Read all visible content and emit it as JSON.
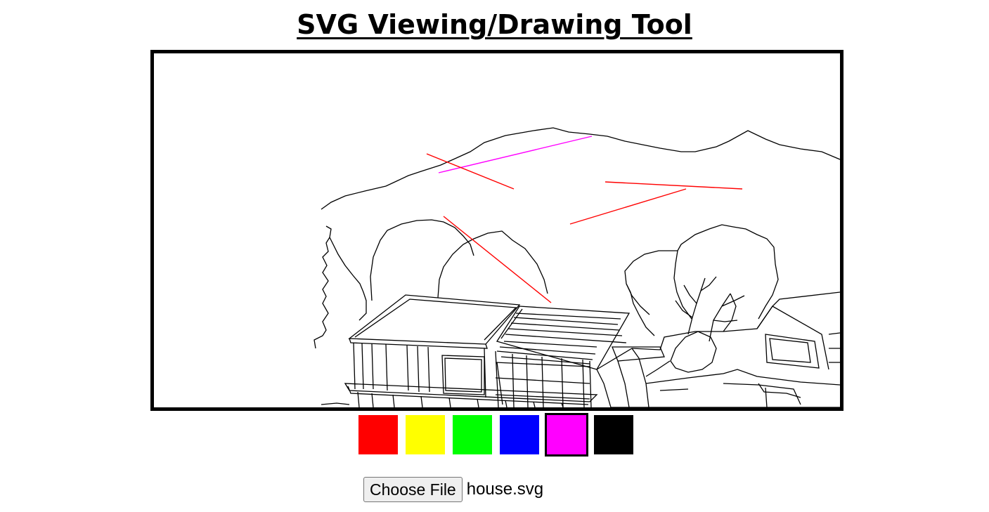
{
  "page": {
    "title": "SVG Viewing/Drawing Tool"
  },
  "palette": {
    "colors": [
      {
        "name": "red",
        "hex": "#ff0000"
      },
      {
        "name": "yellow",
        "hex": "#ffff00"
      },
      {
        "name": "green",
        "hex": "#00ff00"
      },
      {
        "name": "blue",
        "hex": "#0000ff"
      },
      {
        "name": "magenta",
        "hex": "#ff00ff"
      },
      {
        "name": "black",
        "hex": "#000000"
      }
    ],
    "selected": "magenta"
  },
  "file_input": {
    "button_label": "Choose File",
    "file_name": "house.svg"
  },
  "canvas": {
    "loaded_drawing": "house-line-drawing",
    "user_strokes": [
      {
        "color": "#ff00ff"
      },
      {
        "color": "#ff0000"
      },
      {
        "color": "#ff0000"
      },
      {
        "color": "#ff0000"
      },
      {
        "color": "#ff0000"
      }
    ]
  }
}
